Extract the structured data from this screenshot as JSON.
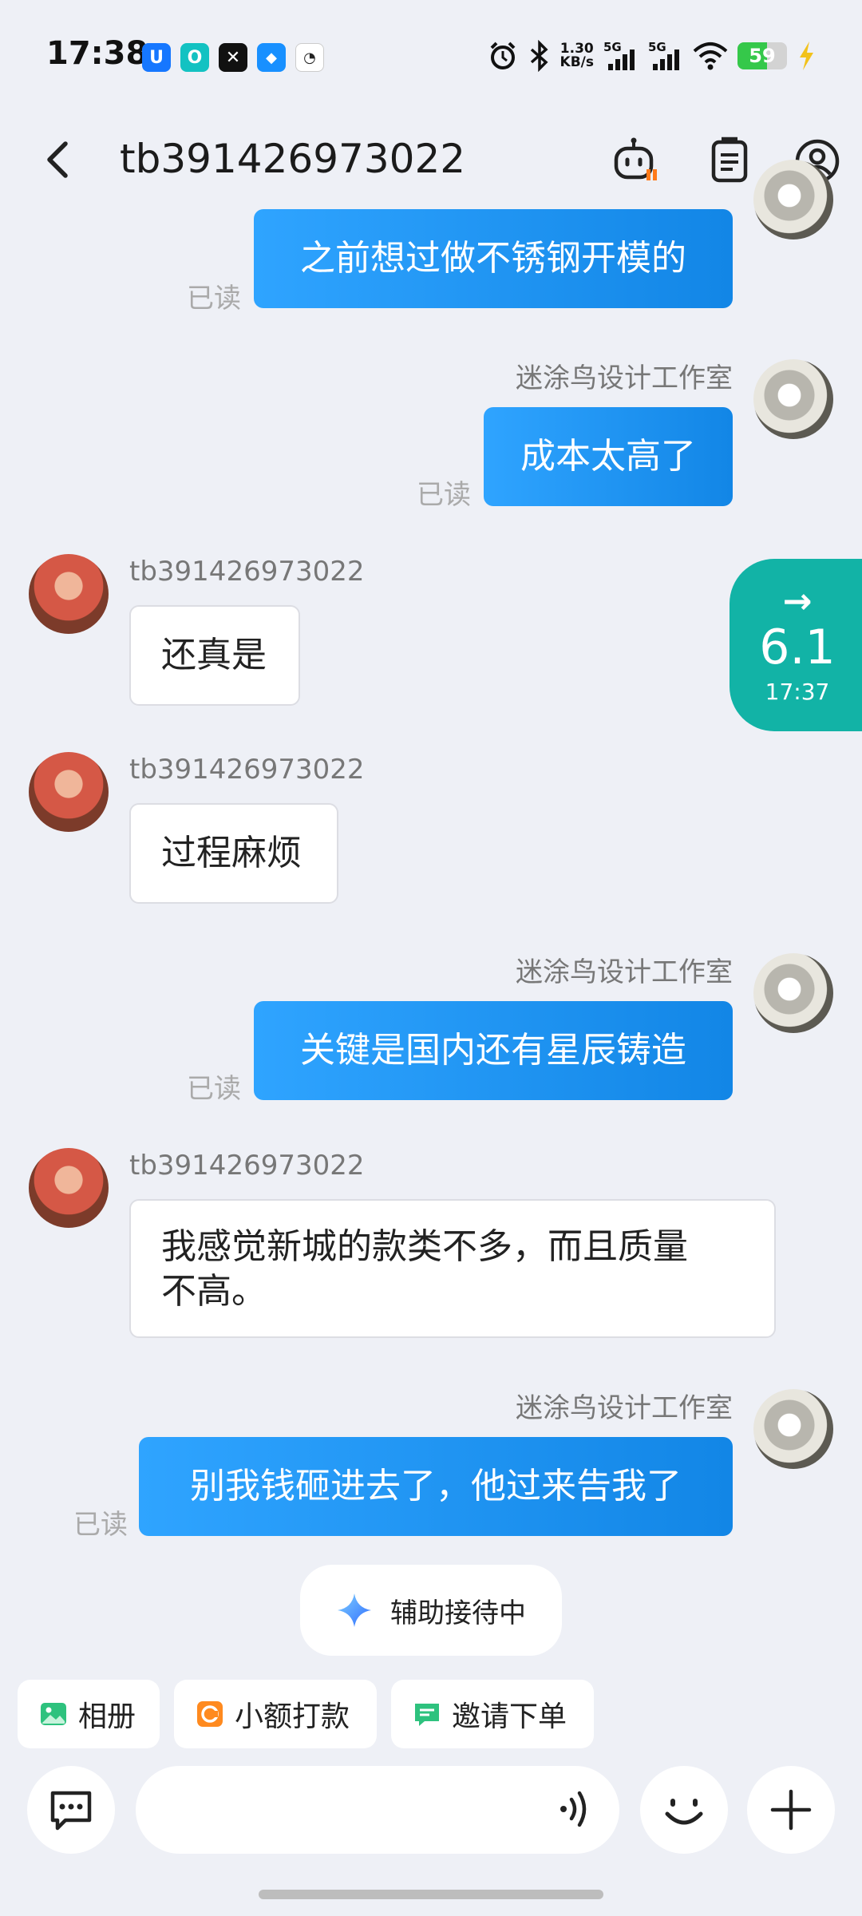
{
  "status_bar": {
    "time": "17:38",
    "app_icons": [
      {
        "name": "shield-app-icon",
        "glyph": "U",
        "color": "#1677ff"
      },
      {
        "name": "o-app-icon",
        "glyph": "O",
        "color": "#13c2c2"
      },
      {
        "name": "capcut-app-icon",
        "glyph": "✕",
        "color": "#111111"
      },
      {
        "name": "cloud-app-icon",
        "glyph": "◆",
        "color": "#1890ff"
      },
      {
        "name": "mute-app-icon",
        "glyph": "◔",
        "color": "#ffffff"
      }
    ],
    "net_speed_value": "1.30",
    "net_speed_unit": "KB/s",
    "signal_1_label": "5G",
    "signal_2_label": "5G",
    "battery_level": "59",
    "battery_fraction": 0.59
  },
  "header": {
    "title": "tb391426973022",
    "icons": [
      "back-arrow-icon",
      "robot-assistant-icon",
      "order-list-icon",
      "user-profile-icon"
    ]
  },
  "messages": [
    {
      "side": "out",
      "sender": "",
      "text": "之前想过做不锈钢开模的",
      "read": "已读"
    },
    {
      "side": "out",
      "sender": "迷涂鸟设计工作室",
      "text": "成本太高了",
      "read": "已读"
    },
    {
      "side": "in",
      "sender": "tb391426973022",
      "text": "还真是"
    },
    {
      "side": "in",
      "sender": "tb391426973022",
      "text": "过程麻烦"
    },
    {
      "side": "out",
      "sender": "迷涂鸟设计工作室",
      "text": "关键是国内还有星辰铸造",
      "read": "已读"
    },
    {
      "side": "in",
      "sender": "tb391426973022",
      "text_line1": "我感觉新城的款类不多，而且质量",
      "text_line2": "不高。"
    },
    {
      "side": "out",
      "sender": "迷涂鸟设计工作室",
      "text": "别我钱砸进去了，他过来告我了",
      "read": "已读"
    }
  ],
  "floating_widget": {
    "arrow": "→",
    "speed": "6.1",
    "time": "17:37",
    "color": "#12b3a6"
  },
  "assist": {
    "label": "辅助接待中",
    "icon": "sparkle-icon"
  },
  "quick_actions": [
    {
      "label": "相册",
      "icon": "photo-album-icon",
      "color": "#2ec27e"
    },
    {
      "label": "小额打款",
      "icon": "payment-icon",
      "color": "#ff8a1f"
    },
    {
      "label": "邀请下单",
      "icon": "invite-order-icon",
      "color": "#2ec27e"
    }
  ],
  "input_bar": {
    "placeholder": "",
    "icons": [
      "chat-mode-icon",
      "voice-icon",
      "emoji-icon",
      "plus-icon"
    ]
  },
  "colors": {
    "accent_blue": "#1a8cf0",
    "background": "#eef0f6"
  }
}
